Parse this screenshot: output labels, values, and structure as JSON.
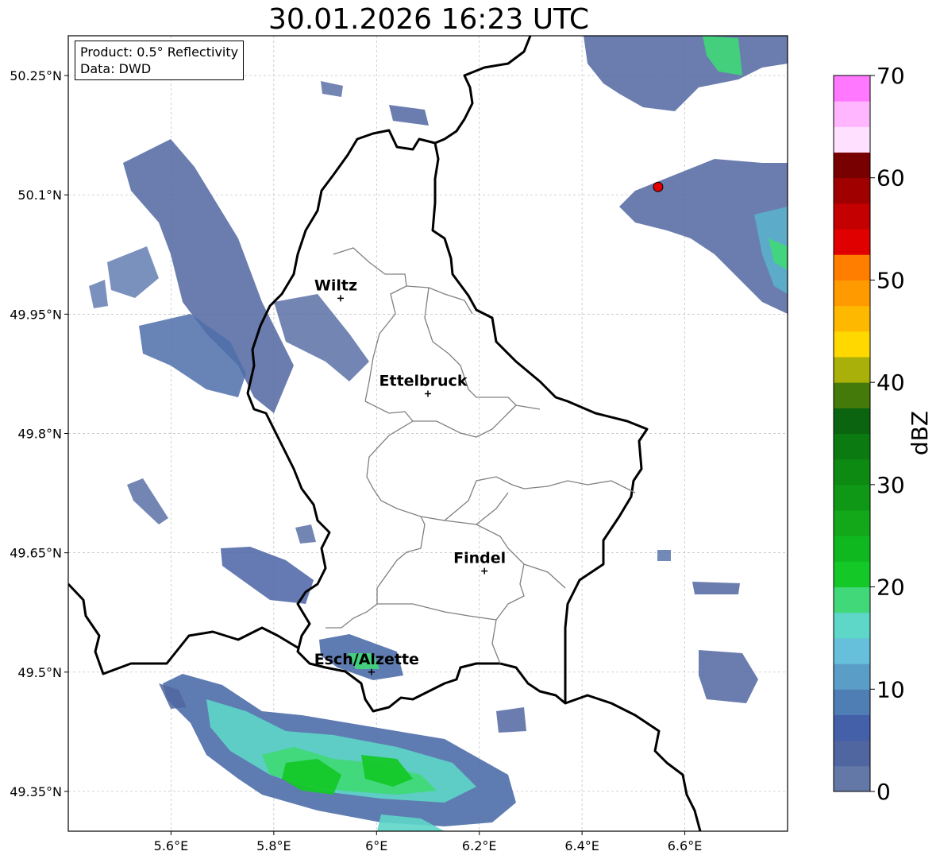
{
  "title": "30.01.2026 16:23 UTC",
  "info": {
    "product": "Product: 0.5° Reflectivity",
    "data": "Data: DWD"
  },
  "map": {
    "lon_range": [
      5.4,
      6.8
    ],
    "lat_range": [
      49.3,
      50.3
    ],
    "x_ticks": [
      {
        "value": 5.6,
        "label": "5.6°E"
      },
      {
        "value": 5.8,
        "label": "5.8°E"
      },
      {
        "value": 6.0,
        "label": "6°E"
      },
      {
        "value": 6.2,
        "label": "6.2°E"
      },
      {
        "value": 6.4,
        "label": "6.4°E"
      },
      {
        "value": 6.6,
        "label": "6.6°E"
      }
    ],
    "y_ticks": [
      {
        "value": 50.25,
        "label": "50.25°N"
      },
      {
        "value": 50.1,
        "label": "50.1°N"
      },
      {
        "value": 49.95,
        "label": "49.95°N"
      },
      {
        "value": 49.8,
        "label": "49.8°N"
      },
      {
        "value": 49.65,
        "label": "49.65°N"
      },
      {
        "value": 49.5,
        "label": "49.5°N"
      },
      {
        "value": 49.35,
        "label": "49.35°N"
      }
    ],
    "cities": [
      {
        "name": "Wiltz",
        "lon": 5.93,
        "lat": 49.97
      },
      {
        "name": "Ettelbruck",
        "lon": 6.1,
        "lat": 49.85
      },
      {
        "name": "Findel",
        "lon": 6.21,
        "lat": 49.627
      },
      {
        "name": "Esch/Alzette",
        "lon": 5.99,
        "lat": 49.5
      }
    ],
    "radar_site": {
      "lon": 6.548,
      "lat": 50.11,
      "color": "#e00000"
    }
  },
  "colorbar": {
    "label": "dBZ",
    "ticks": [
      0,
      10,
      20,
      30,
      40,
      50,
      60,
      70
    ],
    "colors": [
      "#6478a8",
      "#5066a0",
      "#4460a8",
      "#4e7eb4",
      "#5a9ec8",
      "#66c0dc",
      "#5ed6c8",
      "#40d878",
      "#14c828",
      "#10b820",
      "#12a81a",
      "#0f9816",
      "#0d8a12",
      "#0b7a10",
      "#0b6410",
      "#447a0a",
      "#aab00a",
      "#ffd800",
      "#ffb800",
      "#ff9a00",
      "#ff7e00",
      "#e00000",
      "#c40000",
      "#a00000",
      "#780000",
      "#ffe0ff",
      "#ffb6ff",
      "#ff78ff",
      "#ee40ee"
    ]
  }
}
